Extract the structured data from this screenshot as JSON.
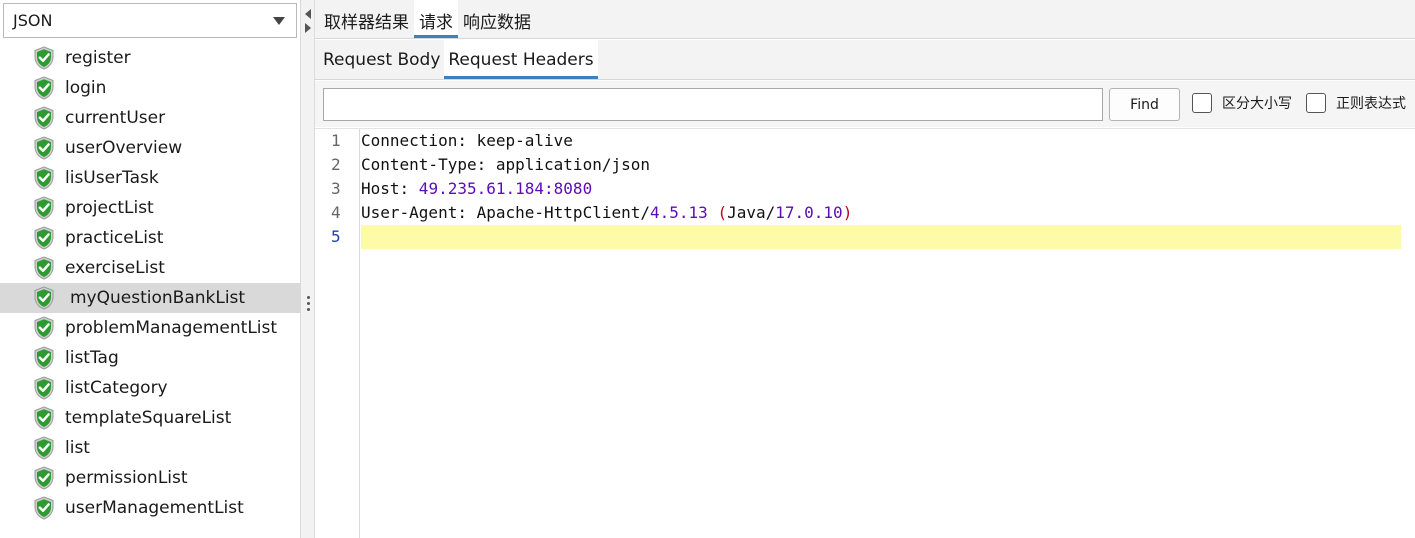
{
  "left": {
    "combo_value": "JSON",
    "items": [
      {
        "label": "register"
      },
      {
        "label": "login"
      },
      {
        "label": "currentUser"
      },
      {
        "label": "userOverview"
      },
      {
        "label": "lisUserTask"
      },
      {
        "label": "projectList"
      },
      {
        "label": "practiceList"
      },
      {
        "label": "exerciseList"
      },
      {
        "label": "myQuestionBankList",
        "selected": true
      },
      {
        "label": "problemManagementList"
      },
      {
        "label": "listTag"
      },
      {
        "label": "listCategory"
      },
      {
        "label": "templateSquareList"
      },
      {
        "label": "list"
      },
      {
        "label": "permissionList"
      },
      {
        "label": "userManagementList"
      }
    ],
    "icon": "success-shield-icon",
    "icon_colors": {
      "shield": "#2e9b32",
      "check": "#ffffff",
      "rim": "#b8b8b8"
    }
  },
  "tabs_main": [
    {
      "label": "取样器结果",
      "active": false
    },
    {
      "label": "请求",
      "active": true
    },
    {
      "label": "响应数据",
      "active": false
    }
  ],
  "tabs_sub": [
    {
      "label": "Request Body",
      "active": false
    },
    {
      "label": "Request Headers",
      "active": true
    }
  ],
  "search": {
    "value": "",
    "find_label": "Find",
    "case_label": "区分大小写",
    "regex_label": "正则表达式"
  },
  "editor": {
    "line_numbers": [
      "1",
      "2",
      "3",
      "4",
      "5"
    ],
    "current_line": 5,
    "lines": {
      "l1": {
        "key": "Connection:",
        "value": " keep-alive"
      },
      "l2": {
        "key": "Content-Type:",
        "v1": " application",
        "sep": "/",
        "v2": "json"
      },
      "l3": {
        "key": "Host:",
        "num": " 49.235.61.184:8080"
      },
      "l4": {
        "key": "User-Agent:",
        "v1": " Apache-HttpClient",
        "s1": "/",
        "n1": "4.5.13",
        "sp": " ",
        "p1": "(",
        "v2": "Java",
        "s2": "/",
        "n2": "17.0.10",
        "p2": ")"
      }
    }
  },
  "colors": {
    "accent": "#3f7fbf",
    "current_line": "#fdfba8",
    "number": "#5a0cb8",
    "paren": "#c4001e",
    "selected_row": "#d9d9d9"
  }
}
